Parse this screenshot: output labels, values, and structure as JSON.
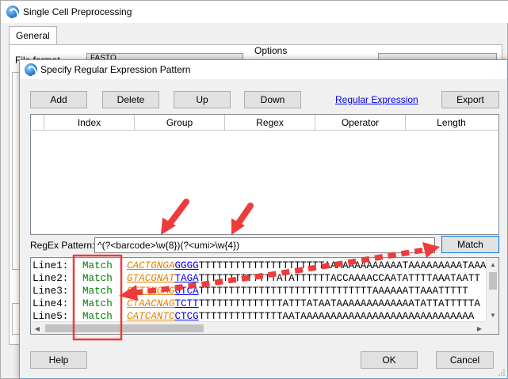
{
  "background_window": {
    "title": "Single Cell Preprocessing",
    "tab": "General",
    "file_format_label": "File format",
    "file_format_value": "FASTQ",
    "options_label": "Options"
  },
  "dialog": {
    "title": "Specify Regular Expression Pattern",
    "toolbar": {
      "add": "Add",
      "delete": "Delete",
      "up": "Up",
      "down": "Down",
      "regex_link": "Regular Expression",
      "export": "Export"
    },
    "grid_columns": [
      "Index",
      "Group",
      "Regex",
      "Operator",
      "Length"
    ],
    "regex_label": "RegEx Pattern:",
    "regex_value": "^(?<barcode>\\w{8})(?<umi>\\w{4})",
    "match_button": "Match",
    "results": [
      {
        "line": "Line1:",
        "status": "Match",
        "barcode": "CACTGNGA",
        "umi": "GGGG",
        "rest": "TTTTTTTTTTTTTTTTTTTTTAAAAAAAAAAAAATAAAAAAAAATAAA"
      },
      {
        "line": "Line2:",
        "status": "Match",
        "barcode": "GTACGNAT",
        "umi": "TAGA",
        "rest": "TTTTTTTTTTTTTATATTTTTTACCAAAACCAATATTTTAAATAATT"
      },
      {
        "line": "Line3:",
        "status": "Match",
        "barcode": "CTTTNGAG",
        "umi": "GTCA",
        "rest": "TTTTTTTTTTTTTTTTTTTTTTTTTTTTTAAAAAATTAAATTTTT"
      },
      {
        "line": "Line4:",
        "status": "Match",
        "barcode": "CTAACNAG",
        "umi": "TCTT",
        "rest": "TTTTTTTTTTTTTTATTTATAATAAAAAAAAAAAAATATTATTTTTA"
      },
      {
        "line": "Line5:",
        "status": "Match",
        "barcode": "CATCANTC",
        "umi": "CTCG",
        "rest": "TTTTTTTTTTTTTTAATAAAAAAAAAAAAAAAAAAAAAAAAAAAAA"
      }
    ],
    "footer": {
      "help": "Help",
      "ok": "OK",
      "cancel": "Cancel"
    }
  },
  "colors": {
    "barcode": "#e08000",
    "umi": "#0000e0",
    "match": "#008000",
    "annotation": "#ee3b3b"
  },
  "icons": {
    "app": "app-logo-icon",
    "arrow_up": "scroll-up-icon",
    "arrow_down": "scroll-down-icon",
    "arrow_left": "scroll-left-icon",
    "arrow_right": "scroll-right-icon"
  }
}
